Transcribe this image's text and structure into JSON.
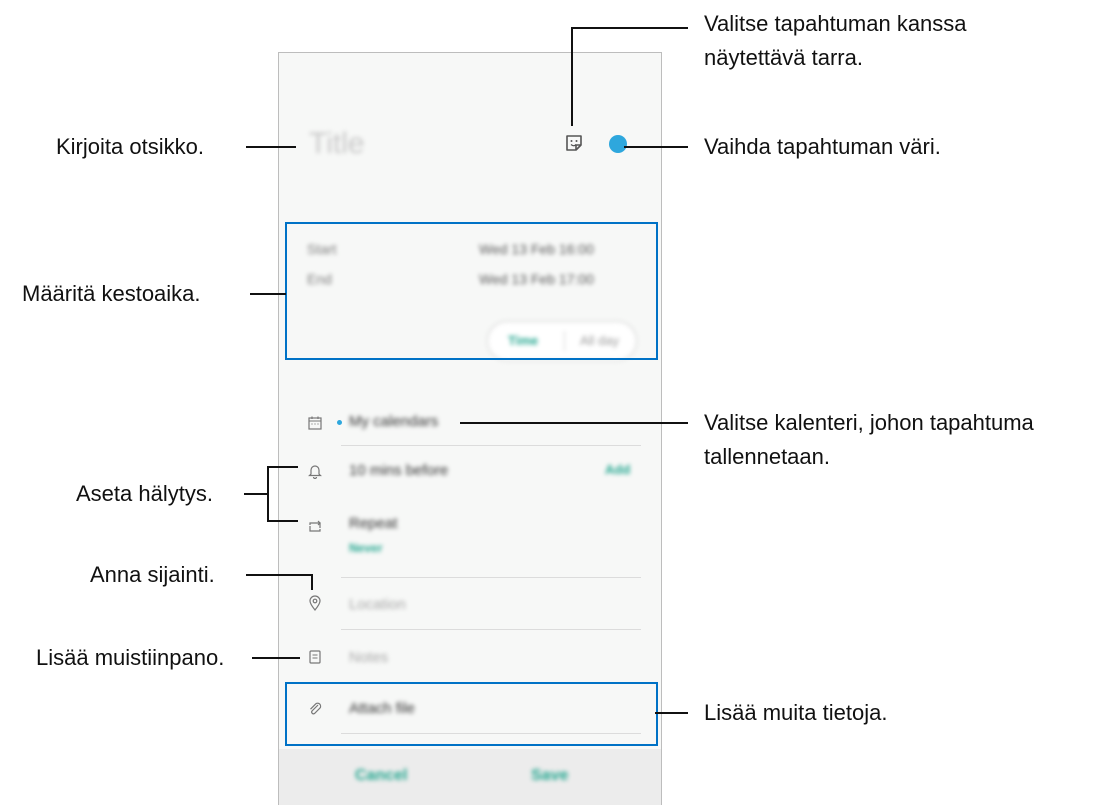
{
  "phone": {
    "title_placeholder": "Title",
    "start_label": "Start",
    "start_value": "Wed 13 Feb  16:00",
    "end_label": "End",
    "end_value": "Wed 13 Feb  17:00",
    "toggle_time": "Time",
    "toggle_allday": "All day",
    "calendar": "My calendars",
    "reminder": "10 mins before",
    "reminder_action": "Add",
    "repeat": "Repeat",
    "repeat_value": "Never",
    "location": "Location",
    "notes": "Notes",
    "attach": "Attach file",
    "cancel": "Cancel",
    "save": "Save",
    "accent_color": "#2ea7dd",
    "action_color": "#23a68f"
  },
  "callouts": {
    "title": "Kirjoita otsikko.",
    "sticker_line1": "Valitse tapahtuman kanssa",
    "sticker_line2": "näytettävä tarra.",
    "color": "Vaihda tapahtuman väri.",
    "duration": "Määritä kestoaika.",
    "calendar_line1": "Valitse kalenteri, johon tapahtuma",
    "calendar_line2": "tallennetaan.",
    "alarm": "Aseta hälytys.",
    "location": "Anna sijainti.",
    "notes": "Lisää muistiinpano.",
    "more": "Lisää muita tietoja."
  }
}
